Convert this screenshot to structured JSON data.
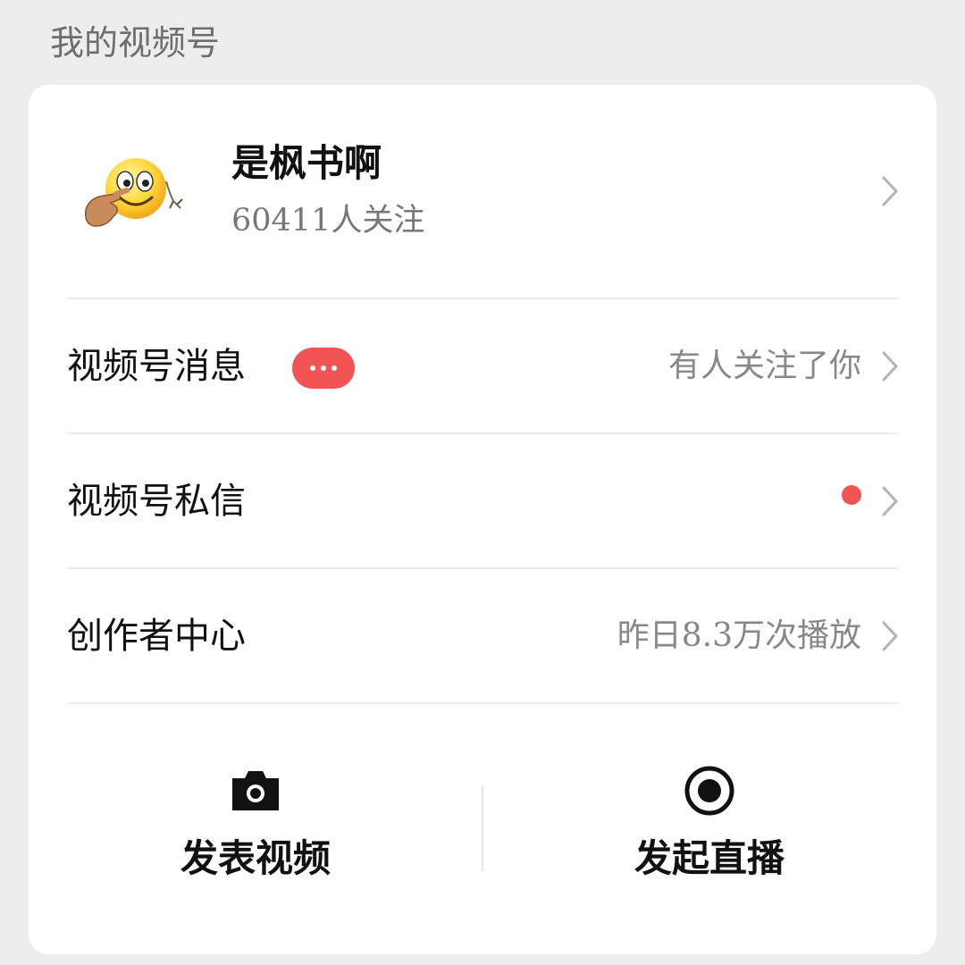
{
  "section": {
    "title": "我的视频号"
  },
  "profile": {
    "name": "是枫书啊",
    "followers": "60411人关注",
    "avatar_icon": "emoji-pointing-avatar"
  },
  "rows": [
    {
      "label": "视频号消息",
      "detail": "有人关注了你",
      "badge": "more-dots-badge"
    },
    {
      "label": "视频号私信",
      "detail": "",
      "indicator": "red-dot"
    },
    {
      "label": "创作者中心",
      "detail": "昨日8.3万次播放"
    }
  ],
  "actions": [
    {
      "label": "发表视频",
      "icon": "camera-icon"
    },
    {
      "label": "发起直播",
      "icon": "live-record-icon"
    }
  ],
  "colors": {
    "accent_red": "#f25454",
    "background": "#ededed",
    "card": "#ffffff"
  }
}
